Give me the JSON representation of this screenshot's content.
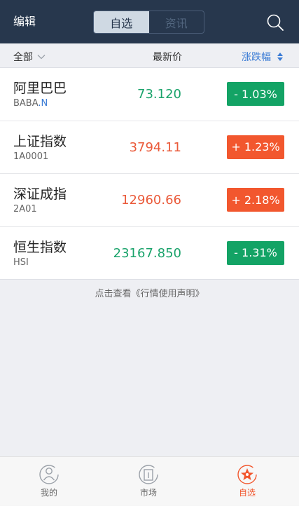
{
  "header": {
    "edit_label": "编辑",
    "tabs": [
      {
        "label": "自选",
        "active": true
      },
      {
        "label": "资讯",
        "active": false
      }
    ],
    "search_icon": "search-icon"
  },
  "columns": {
    "all_label": "全部",
    "price_label": "最新价",
    "change_label": "涨跌幅"
  },
  "stocks": [
    {
      "name": "阿里巴巴",
      "code": "BABA",
      "market_suffix": ".N",
      "price": "73.120",
      "change": "- 1.03%",
      "direction": "down"
    },
    {
      "name": "上证指数",
      "code": "1A0001",
      "market_suffix": "",
      "price": "3794.11",
      "change": "+ 1.23%",
      "direction": "up"
    },
    {
      "name": "深证成指",
      "code": "2A01",
      "market_suffix": "",
      "price": "12960.66",
      "change": "+ 2.18%",
      "direction": "up"
    },
    {
      "name": "恒生指数",
      "code": "HSI",
      "market_suffix": "",
      "price": "23167.850",
      "change": "- 1.31%",
      "direction": "down"
    }
  ],
  "disclaimer": "点击查看《行情使用声明》",
  "tabbar": [
    {
      "label": "我的",
      "icon": "profile-icon",
      "active": false
    },
    {
      "label": "市场",
      "icon": "market-icon",
      "active": false
    },
    {
      "label": "自选",
      "icon": "star-icon",
      "active": true
    }
  ],
  "colors": {
    "header_bg": "#27374d",
    "up": "#f2572e",
    "down": "#13a365",
    "accent": "#3a7bd5"
  }
}
